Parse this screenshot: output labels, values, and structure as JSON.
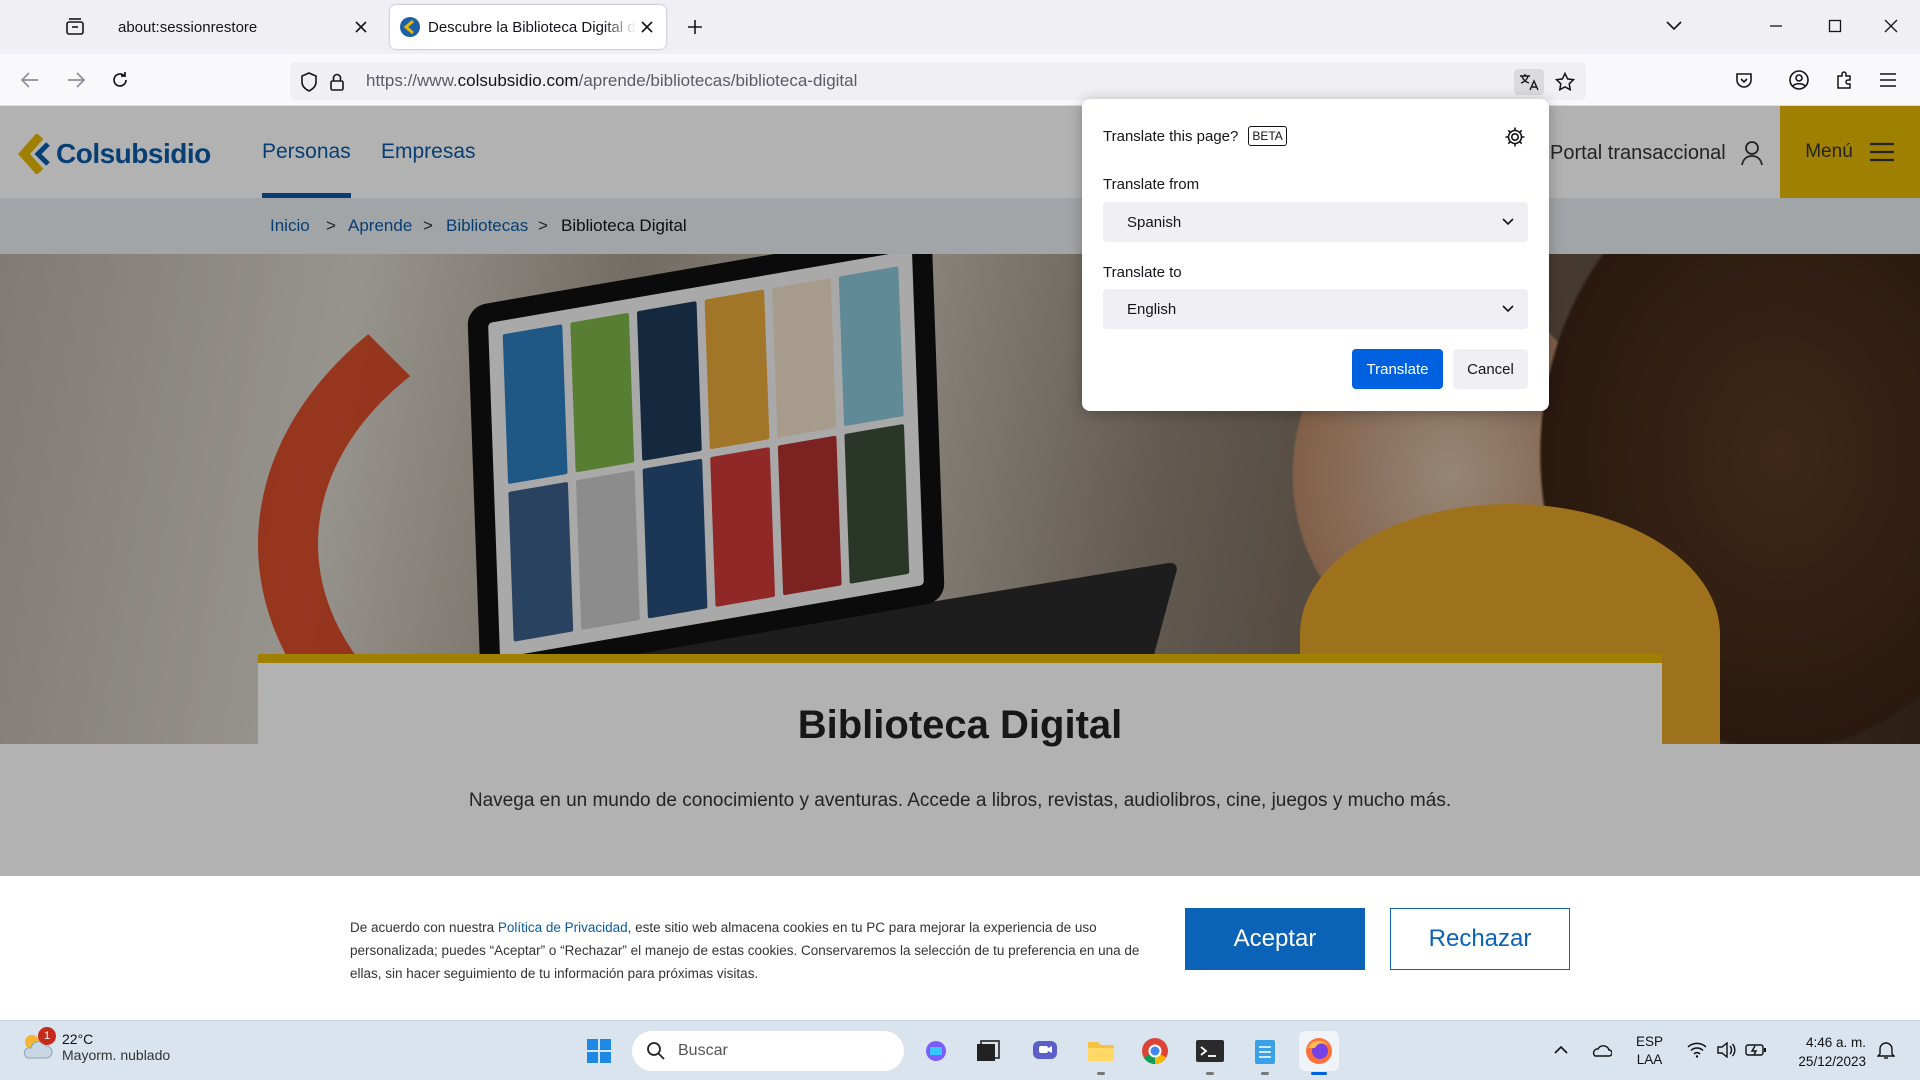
{
  "browser": {
    "tabs": [
      {
        "title": "about:sessionrestore",
        "active": false
      },
      {
        "title": "Descubre la Biblioteca Digital de Colsubsidio",
        "active": true
      }
    ],
    "url": {
      "prefix": "https://www.",
      "domain": "colsubsidio.com",
      "path": "/aprende/bibliotecas/biblioteca-digital"
    }
  },
  "site": {
    "logo": "Colsubsidio",
    "nav": [
      {
        "label": "Personas",
        "active": true
      },
      {
        "label": "Empresas",
        "active": false
      }
    ],
    "portal": "Portal transaccional",
    "menu": "Menú",
    "breadcrumb": [
      "Inicio",
      "Aprende",
      "Bibliotecas",
      "Biblioteca Digital"
    ],
    "breadcrumb_sep": ">",
    "hero_title": "Biblioteca Digital",
    "hero_subtitle": "Navega en un mundo de conocimiento y aventuras. Accede a libros, revistas, audiolibros, cine, juegos y mucho más."
  },
  "cookie": {
    "text_before": "De acuerdo con nuestra ",
    "link": "Política de Privacidad",
    "text_after": ", este sitio web almacena cookies en tu PC para mejorar la experiencia de uso personalizada; puedes “Aceptar” o “Rechazar” el manejo de estas cookies. Conservaremos la selección de tu preferencia en una de ellas, sin hacer seguimiento de tu información para próximas visitas.",
    "accept": "Aceptar",
    "reject": "Rechazar"
  },
  "translate_panel": {
    "title": "Translate this page?",
    "badge": "BETA",
    "from_label": "Translate from",
    "from_value": "Spanish",
    "to_label": "Translate to",
    "to_value": "English",
    "translate_button": "Translate",
    "cancel_button": "Cancel"
  },
  "taskbar": {
    "weather_temp": "22°C",
    "weather_desc": "Mayorm. nublado",
    "weather_badge": "1",
    "search_placeholder": "Buscar",
    "lang_top": "ESP",
    "lang_bottom": "LAA",
    "time": "4:46 a. m.",
    "date": "25/12/2023"
  },
  "colors": {
    "brand_blue": "#0b5aa5",
    "brand_yellow": "#e6b800",
    "firefox_blue": "#0061e0"
  }
}
